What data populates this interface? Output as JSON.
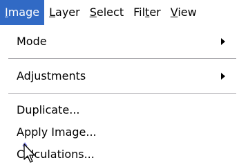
{
  "menubar": {
    "items": [
      {
        "accel": "I",
        "rest": "mage",
        "active": true
      },
      {
        "accel": "L",
        "rest": "ayer"
      },
      {
        "accel": "S",
        "rest": "elect"
      },
      {
        "prefix": "Fil",
        "accel": "t",
        "rest": "er"
      },
      {
        "accel": "V",
        "rest": "iew"
      }
    ]
  },
  "menu": {
    "mode": "Mode",
    "adjustments": "Adjustments",
    "duplicate": "Duplicate...",
    "apply_image": "Apply Image...",
    "calculations": "Calculations..."
  },
  "colors": {
    "highlight": "#316ac5",
    "separator": "#a7a6aa"
  },
  "icons": [
    "submenu-arrow-icon",
    "mouse-cursor-icon"
  ]
}
